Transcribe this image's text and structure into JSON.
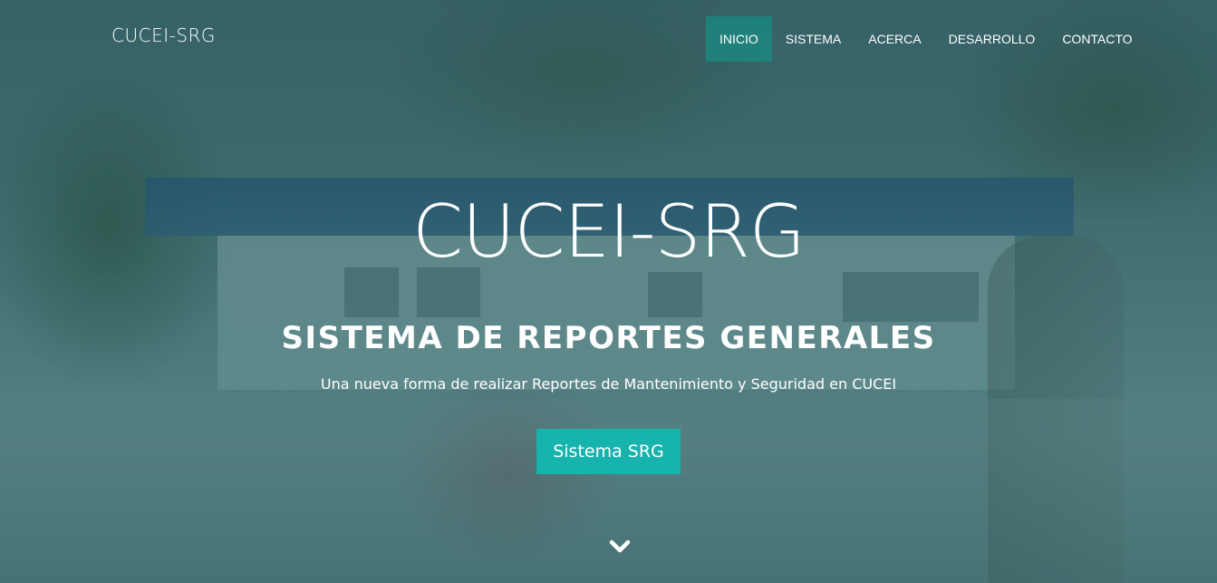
{
  "navbar": {
    "brand": "CUCEI-SRG",
    "items": [
      {
        "label": "INICIO",
        "active": true
      },
      {
        "label": "SISTEMA",
        "active": false
      },
      {
        "label": "ACERCA",
        "active": false
      },
      {
        "label": "DESARROLLO",
        "active": false
      },
      {
        "label": "CONTACTO",
        "active": false
      }
    ]
  },
  "hero": {
    "title": "CUCEI-SRG",
    "subtitle": "SISTEMA DE REPORTES GENERALES",
    "description": "Una nueva forma de realizar Reportes de Mantenimiento y Seguridad en CUCEI",
    "button_label": "Sistema SRG",
    "scroll_icon": "chevron-down-icon"
  },
  "colors": {
    "accent": "#17b3ad",
    "nav_active": "#188c82",
    "overlay": "#245c64"
  }
}
